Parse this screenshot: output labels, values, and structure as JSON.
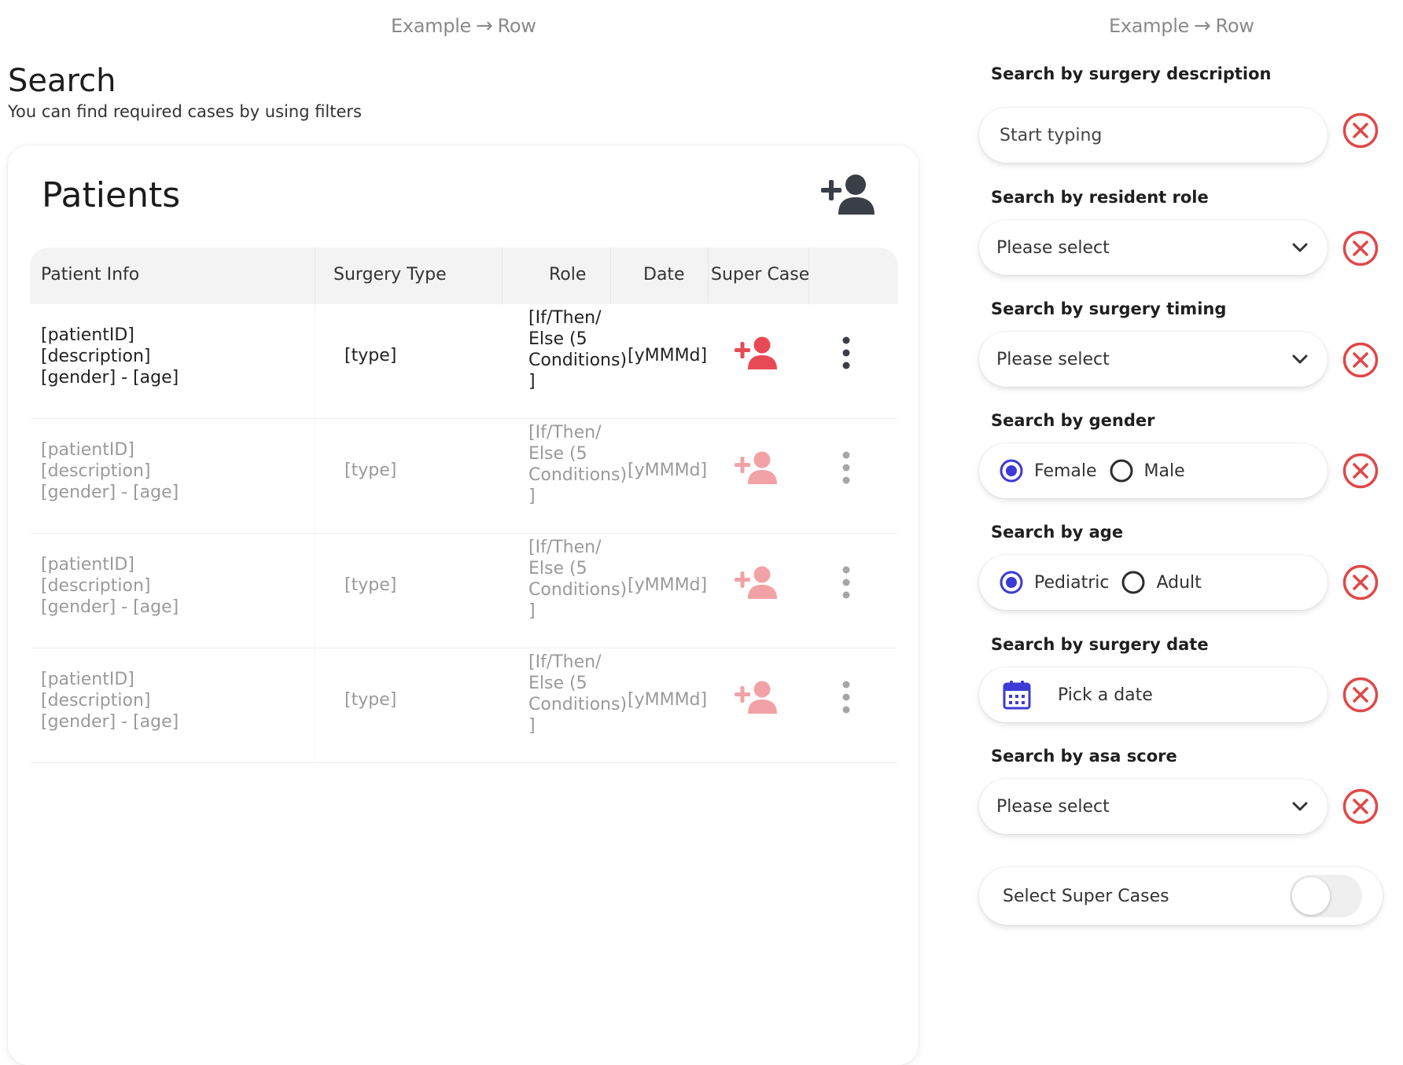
{
  "example_labels": {
    "left": {
      "start": "Example",
      "end": "Row"
    },
    "right": {
      "start": "Example",
      "end": "Row"
    }
  },
  "search": {
    "title": "Search",
    "subtitle": "You can find required cases by using filters"
  },
  "patients_card": {
    "title": "Patients",
    "columns": [
      "Patient Info",
      "Surgery Type",
      "Role",
      "Date",
      "Super Case"
    ],
    "rows": [
      {
        "info": [
          "[patientID]",
          "[description]",
          "[gender] - [age]"
        ],
        "type": "[type]",
        "role": [
          "[If/Then/",
          "Else (5",
          "Conditions)",
          "]"
        ],
        "date": "[yMMMd]",
        "faded": false
      },
      {
        "info": [
          "[patientID]",
          "[description]",
          "[gender] - [age]"
        ],
        "type": "[type]",
        "role": [
          "[If/Then/",
          "Else (5",
          "Conditions)",
          "]"
        ],
        "date": "[yMMMd]",
        "faded": true
      },
      {
        "info": [
          "[patientID]",
          "[description]",
          "[gender] - [age]"
        ],
        "type": "[type]",
        "role": [
          "[If/Then/",
          "Else (5",
          "Conditions)",
          "]"
        ],
        "date": "[yMMMd]",
        "faded": true
      },
      {
        "info": [
          "[patientID]",
          "[description]",
          "[gender] - [age]"
        ],
        "type": "[type]",
        "role": [
          "[If/Then/",
          "Else (5",
          "Conditions)",
          "]"
        ],
        "date": "[yMMMd]",
        "faded": true
      }
    ]
  },
  "filters": {
    "surgery_description": {
      "label": "Search by surgery description",
      "placeholder": "Start typing"
    },
    "resident_role": {
      "label": "Search by resident role",
      "value": "Please select"
    },
    "surgery_timing": {
      "label": "Search by surgery timing",
      "value": "Please select"
    },
    "gender": {
      "label": "Search by gender",
      "options": [
        "Female",
        "Male"
      ],
      "selected": "Female"
    },
    "age": {
      "label": "Search by age",
      "options": [
        "Pediatric",
        "Adult"
      ],
      "selected": "Pediatric"
    },
    "surgery_date": {
      "label": "Search by surgery date",
      "placeholder": "Pick a date"
    },
    "asa_score": {
      "label": "Search by asa score",
      "value": "Please select"
    },
    "super_cases": {
      "label": "Select Super Cases",
      "enabled": false
    }
  },
  "colors": {
    "accent": "#3d3ad6",
    "clear_red": "#e04848",
    "super_case_red": "#e84a55",
    "icon_dark": "#3a3f47"
  },
  "icons": {
    "add_patient": "add-user-icon",
    "super_case": "add-user-icon",
    "row_menu": "more-vertical-icon",
    "clear": "close-circle-icon",
    "dropdown": "chevron-down-icon",
    "date": "calendar-icon"
  }
}
